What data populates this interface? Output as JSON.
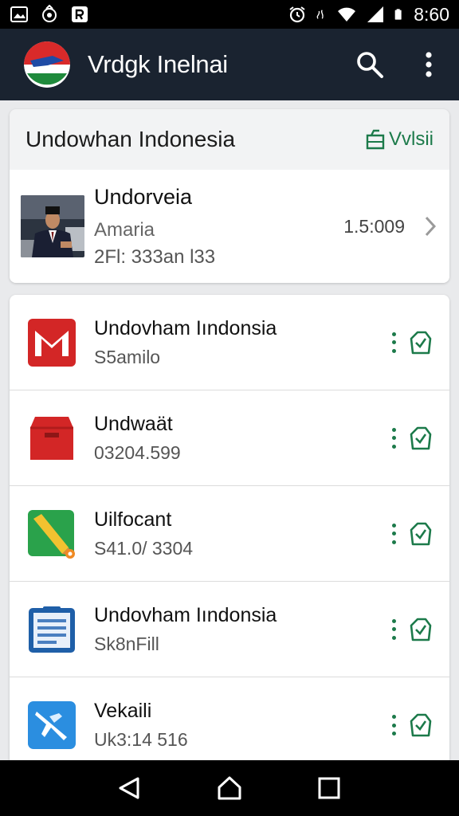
{
  "status_bar": {
    "time": "8:60",
    "icons": [
      "image-icon",
      "app-icon",
      "r-icon",
      "alarm-icon",
      "settings-icon",
      "wifi-icon",
      "signal-icon",
      "battery-icon"
    ]
  },
  "app_bar": {
    "title": "Vrdgk Inelnai",
    "actions": [
      "search-icon",
      "more-vert-icon"
    ]
  },
  "header_card": {
    "title": "Undowhan Indonesia",
    "link_label": "Vvlsii",
    "feature": {
      "name": "Undorveia",
      "subtitle": "Amaria",
      "meta": "2Fl: 333an l33",
      "value": "1.5:009"
    }
  },
  "list": [
    {
      "name": "Undovham Iındonsia",
      "sub": "S5amilo",
      "icon": "mail-icon",
      "color": "#d32626"
    },
    {
      "name": "Undwaät",
      "sub": "03204.599",
      "icon": "inbox-icon",
      "color": "#d32626"
    },
    {
      "name": "Uilfocant",
      "sub": "S41.0/ 3304",
      "icon": "pencil-icon",
      "color": "#2aa24b"
    },
    {
      "name": "Undovham Iındonsia",
      "sub": "Sk8nFill",
      "icon": "document-icon",
      "color": "#1f5fa8"
    },
    {
      "name": "Vekaili",
      "sub": "Uk3:14 516",
      "icon": "plane-icon",
      "color": "#2b8ee0"
    }
  ],
  "colors": {
    "app_bar": "#1a2330",
    "accent": "#1c7a4a",
    "background": "#e9eaec"
  },
  "nav_bar": [
    "back-icon",
    "home-icon",
    "recents-icon"
  ]
}
